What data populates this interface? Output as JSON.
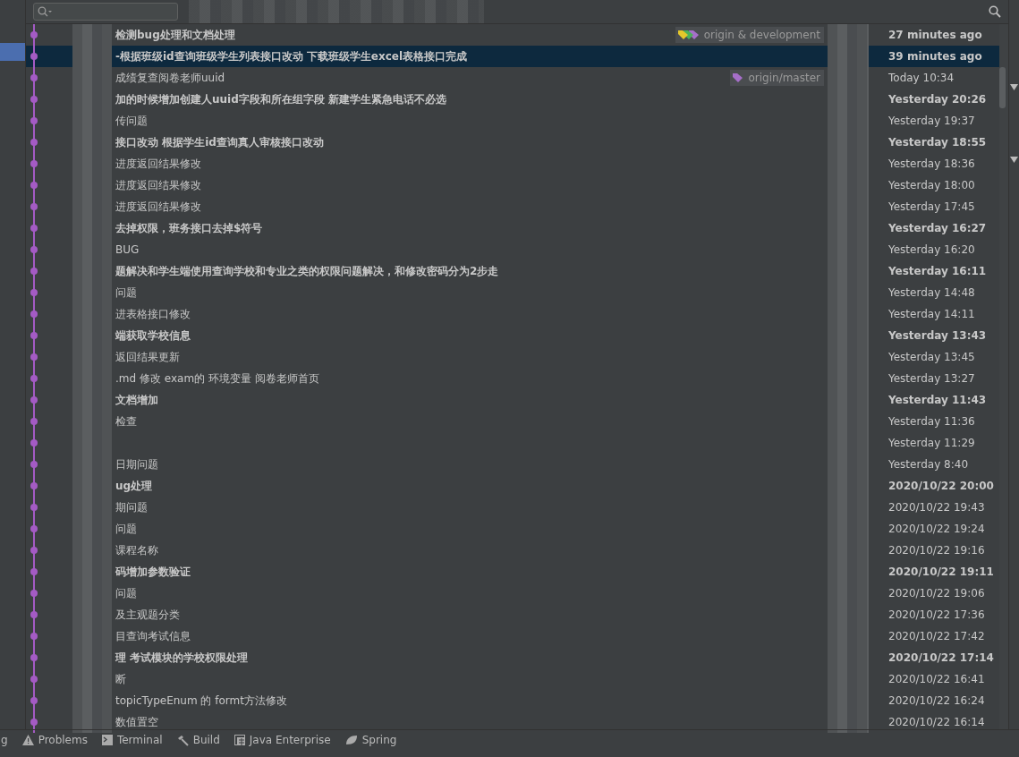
{
  "commits": [
    {
      "message": "检测bug处理和文档处理",
      "date": "27 minutes ago",
      "bold": true,
      "selected": false,
      "ref": {
        "label": "origin & development",
        "tags": [
          {
            "color": "#e5c82b"
          },
          {
            "color": "#4cb05a"
          },
          {
            "color": "#a66fc9"
          }
        ]
      }
    },
    {
      "message": "-根据班级id查询班级学生列表接口改动 下载班级学生excel表格接口完成",
      "date": "39 minutes ago",
      "bold": true,
      "selected": true
    },
    {
      "message": "成绩复查阅卷老师uuid",
      "date": "Today 10:34",
      "bold": false,
      "selected": false,
      "ref": {
        "label": "origin/master",
        "tags": [
          {
            "color": "#a66fc9"
          }
        ]
      }
    },
    {
      "message": "加的时候增加创建人uuid字段和所在组字段 新建学生紧急电话不必选",
      "date": "Yesterday 20:26",
      "bold": true,
      "selected": false
    },
    {
      "message": "传问题",
      "date": "Yesterday 19:37",
      "bold": false,
      "selected": false
    },
    {
      "message": "接口改动 根据学生id查询真人审核接口改动",
      "date": "Yesterday 18:55",
      "bold": true,
      "selected": false
    },
    {
      "message": "进度返回结果修改",
      "date": "Yesterday 18:36",
      "bold": false,
      "selected": false
    },
    {
      "message": "进度返回结果修改",
      "date": "Yesterday 18:00",
      "bold": false,
      "selected": false
    },
    {
      "message": "进度返回结果修改",
      "date": "Yesterday 17:45",
      "bold": false,
      "selected": false
    },
    {
      "message": "去掉权限，班务接口去掉$符号",
      "date": "Yesterday 16:27",
      "bold": true,
      "selected": false
    },
    {
      "message": "BUG",
      "date": "Yesterday 16:20",
      "bold": false,
      "selected": false
    },
    {
      "message": "题解决和学生端使用查询学校和专业之类的权限问题解决，和修改密码分为2步走",
      "date": "Yesterday 16:11",
      "bold": true,
      "selected": false
    },
    {
      "message": "问题",
      "date": "Yesterday 14:48",
      "bold": false,
      "selected": false
    },
    {
      "message": "进表格接口修改",
      "date": "Yesterday 14:11",
      "bold": false,
      "selected": false
    },
    {
      "message": "端获取学校信息",
      "date": "Yesterday 13:43",
      "bold": true,
      "selected": false
    },
    {
      "message": "返回结果更新",
      "date": "Yesterday 13:45",
      "bold": false,
      "selected": false
    },
    {
      "message": ".md 修改 exam的 环境变量 阅卷老师首页",
      "date": "Yesterday 13:27",
      "bold": false,
      "selected": false
    },
    {
      "message": "文档增加",
      "date": "Yesterday 11:43",
      "bold": true,
      "selected": false
    },
    {
      "message": "检查",
      "date": "Yesterday 11:36",
      "bold": false,
      "selected": false
    },
    {
      "date": "Yesterday 11:29",
      "bold": false,
      "selected": false
    },
    {
      "message": "日期问题",
      "date": "Yesterday 8:40",
      "bold": false,
      "selected": false
    },
    {
      "message": "ug处理",
      "date": "2020/10/22 20:00",
      "bold": true,
      "selected": false
    },
    {
      "message": "期问题",
      "date": "2020/10/22 19:43",
      "bold": false,
      "selected": false
    },
    {
      "message": "问题",
      "date": "2020/10/22 19:24",
      "bold": false,
      "selected": false
    },
    {
      "message": "课程名称",
      "date": "2020/10/22 19:16",
      "bold": false,
      "selected": false
    },
    {
      "message": "码增加参数验证",
      "date": "2020/10/22 19:11",
      "bold": true,
      "selected": false
    },
    {
      "message": "问题",
      "date": "2020/10/22 19:06",
      "bold": false,
      "selected": false
    },
    {
      "message": "及主观题分类",
      "date": "2020/10/22 17:36",
      "bold": false,
      "selected": false
    },
    {
      "message": "目查询考试信息",
      "date": "2020/10/22 17:42",
      "bold": false,
      "selected": false
    },
    {
      "message": "理 考试模块的学校权限处理",
      "date": "2020/10/22 17:14",
      "bold": true,
      "selected": false
    },
    {
      "message": "断",
      "date": "2020/10/22 16:41",
      "bold": false,
      "selected": false
    },
    {
      "message": "topicTypeEnum 的 formt方法修改",
      "date": "2020/10/22 16:24",
      "bold": false,
      "selected": false
    },
    {
      "message": "数值置空",
      "date": "2020/10/22 16:14",
      "bold": false,
      "selected": false
    }
  ],
  "tool_windows": [
    {
      "label": "g",
      "kind": "none"
    },
    {
      "label": "Problems",
      "kind": "problems"
    },
    {
      "label": "Terminal",
      "kind": "terminal"
    },
    {
      "label": "Build",
      "kind": "build"
    },
    {
      "label": "Java Enterprise",
      "kind": "enterprise"
    },
    {
      "label": "Spring",
      "kind": "spring"
    }
  ]
}
